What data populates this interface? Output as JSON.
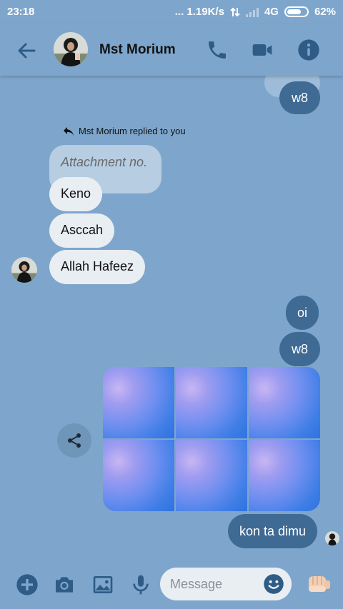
{
  "status_bar": {
    "time": "23:18",
    "network_speed": "... 1.19K/s",
    "network_type": "4G",
    "battery": "62%"
  },
  "header": {
    "contact_name": "Mst Morium",
    "icons": [
      "back-arrow-icon",
      "phone-icon",
      "video-camera-icon",
      "info-icon"
    ]
  },
  "conversation": {
    "messages_top": [
      {
        "direction": "outgoing",
        "text": "w8"
      }
    ],
    "reply_note": "Mst Morium replied to you",
    "quoted_text": "Attachment no.",
    "incoming": [
      {
        "text": "Keno"
      },
      {
        "text": "Asccah"
      },
      {
        "text": "Allah Hafeez"
      }
    ],
    "outgoing": [
      {
        "text": "oi"
      },
      {
        "text": "w8"
      }
    ],
    "image_grid_count": 6,
    "last_outgoing": {
      "text": "kon ta dimu"
    }
  },
  "composer": {
    "placeholder": "Message",
    "icons": [
      "add-icon",
      "camera-icon",
      "gallery-icon",
      "microphone-icon",
      "emoji-icon",
      "fist-bump-icon"
    ]
  },
  "colors": {
    "background": "#7ea6cc",
    "outgoing_bubble": "#3e6a94",
    "incoming_bubble": "#e9eef3",
    "icon": "#2f5b87"
  }
}
